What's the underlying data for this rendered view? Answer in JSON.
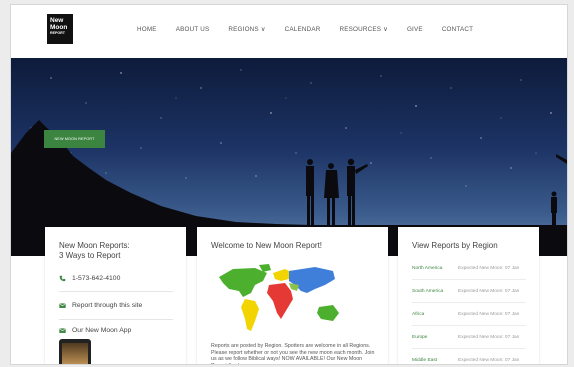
{
  "logo": {
    "line1": "New",
    "line2": "Moon",
    "line3": "REPORT"
  },
  "nav": {
    "items": [
      {
        "label": "HOME"
      },
      {
        "label": "ABOUT US"
      },
      {
        "label": "REGIONS ∨"
      },
      {
        "label": "CALENDAR"
      },
      {
        "label": "RESOURCES ∨"
      },
      {
        "label": "GIVE"
      },
      {
        "label": "CONTACT"
      }
    ]
  },
  "hero": {
    "button_label": "NEW MOON REPORT"
  },
  "ways": {
    "title_line1": "New Moon Reports:",
    "title_line2": "3 Ways to Report",
    "phone": "1-573-642-4100",
    "site_link": "Report through this site",
    "app_link": "Our New Moon App"
  },
  "welcome": {
    "title": "Welcome to New Moon Report!",
    "para": "Reports are posted by Region. Spotters are welcome in all Regions. Please report whether or not you see the new moon each month. Join us as we follow Biblical ways! NOW AVAILABLE! Our New Moon Report App!"
  },
  "regions": {
    "title": "View Reports by Region",
    "items": [
      {
        "name": "North America",
        "date": "Expected New Moon: 07 Jan"
      },
      {
        "name": "South America",
        "date": "Expected New Moon: 07 Jan"
      },
      {
        "name": "Africa",
        "date": "Expected New Moon: 07 Jan"
      },
      {
        "name": "Europe",
        "date": "Expected New Moon: 07 Jan"
      },
      {
        "name": "Middle East",
        "date": "Expected New Moon: 07 Jan"
      }
    ]
  },
  "colors": {
    "accent_green": "#3c8540",
    "sky_dark": "#0d1b3b"
  }
}
